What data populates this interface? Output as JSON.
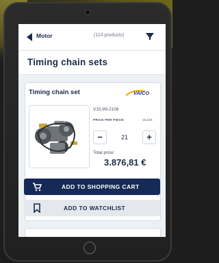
{
  "nav": {
    "back_label": "Motor",
    "product_count": "(114 products)"
  },
  "page": {
    "title": "Timing chain sets"
  },
  "product": {
    "name": "Timing chain set",
    "brand": "VAICO",
    "part_number": "V15-99-2106",
    "price_per_piece_label": "PRICE PER PIECE:",
    "price_per_piece_value": "15,21€",
    "quantity": "21",
    "minus_label": "−",
    "plus_label": "+",
    "total_label": "Total price:",
    "total_value": "3.876,81 €"
  },
  "actions": {
    "add_to_cart": "ADD TO SHOPPING CART",
    "add_to_watchlist": "ADD TO WATCHLIST"
  },
  "colors": {
    "navy": "#152a56",
    "text": "#1a2b4a",
    "background": "#eef1f4"
  },
  "icons": [
    "back-arrow-icon",
    "filter-icon",
    "cart-icon",
    "bookmark-icon"
  ]
}
